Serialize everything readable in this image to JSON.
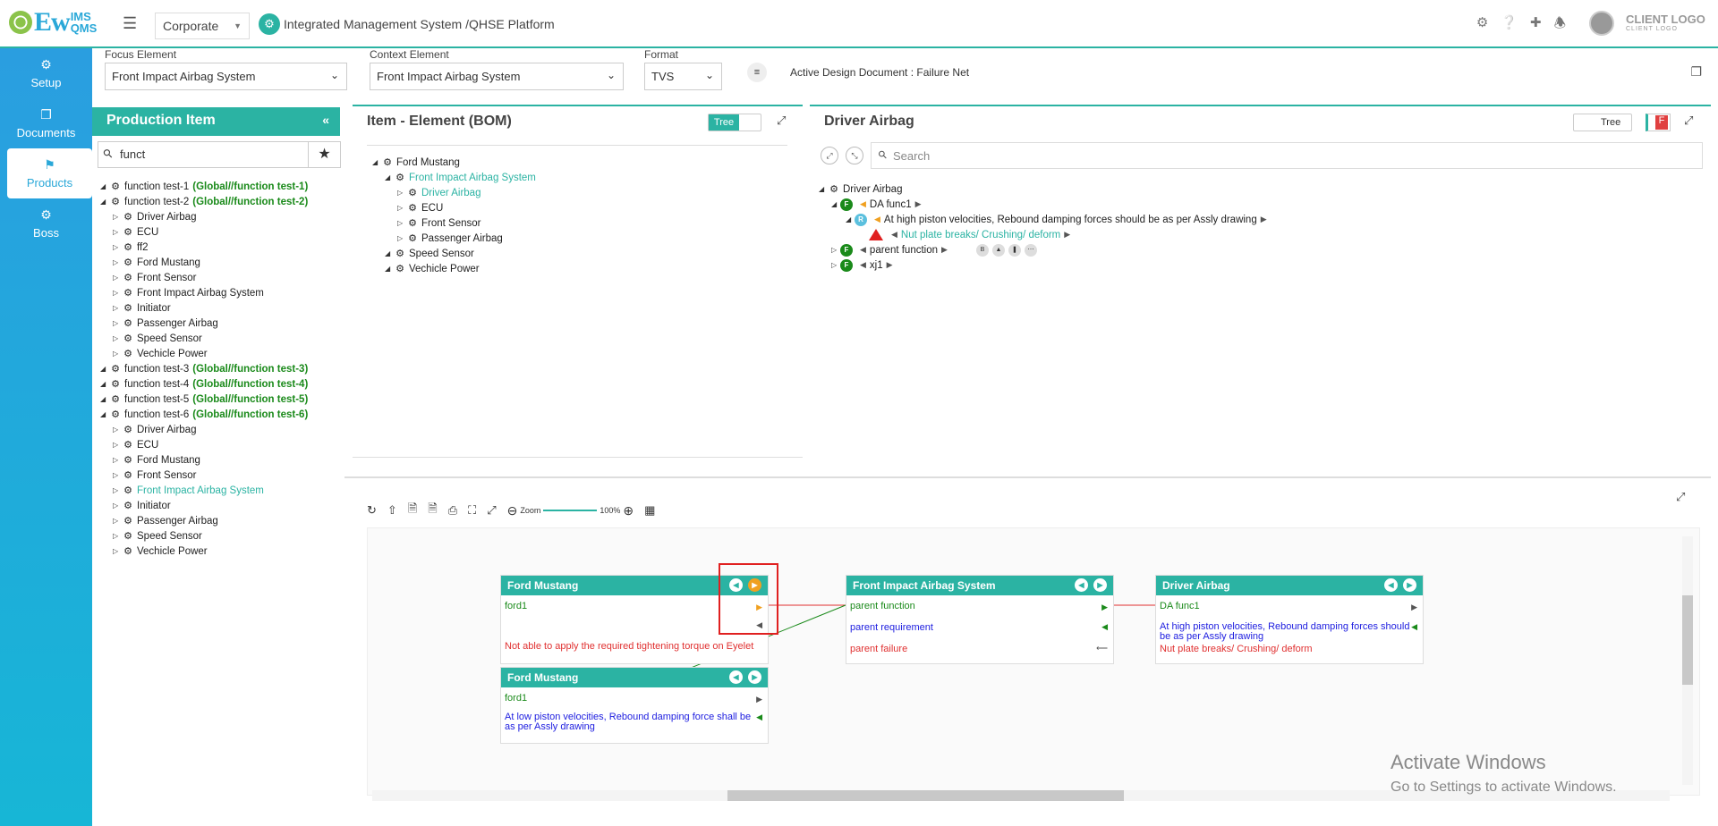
{
  "brand": {
    "logo_main": "Ew",
    "logo_top": "IMS",
    "logo_bottom": "QMS",
    "client_logo": "CLIENT LOGO",
    "client_logo_sub": "CLIENT LOGO"
  },
  "header": {
    "org_select": "Corporate",
    "app_title": "Integrated Management System /QHSE Platform"
  },
  "sidebar": {
    "items": [
      {
        "label": "Setup",
        "icon": "gears-icon"
      },
      {
        "label": "Documents",
        "icon": "documents-icon"
      },
      {
        "label": "Products",
        "icon": "flag-icon"
      },
      {
        "label": "Boss",
        "icon": "gears-icon"
      }
    ]
  },
  "focus": {
    "focus_label": "Focus Element",
    "focus_value": "Front Impact Airbag System",
    "context_label": "Context Element",
    "context_value": "Front Impact Airbag System",
    "format_label": "Format",
    "format_value": "TVS",
    "active_doc": "Active Design Document : Failure Net"
  },
  "production": {
    "title": "Production Item",
    "search_value": "funct",
    "tree": [
      {
        "label": "function test-1",
        "tag": "(Global//function test-1)",
        "level": 0
      },
      {
        "label": "function test-2",
        "tag": "(Global//function test-2)",
        "level": 0
      },
      {
        "label": "Driver Airbag",
        "level": 1
      },
      {
        "label": "ECU",
        "level": 1
      },
      {
        "label": "ff2",
        "level": 1
      },
      {
        "label": "Ford Mustang",
        "level": 1
      },
      {
        "label": "Front Sensor",
        "level": 1
      },
      {
        "label": "Front Impact Airbag System",
        "level": 1
      },
      {
        "label": "Initiator",
        "level": 1
      },
      {
        "label": "Passenger Airbag",
        "level": 1
      },
      {
        "label": "Speed Sensor",
        "level": 1
      },
      {
        "label": "Vechicle Power",
        "level": 1
      },
      {
        "label": "function test-3",
        "tag": "(Global//function test-3)",
        "level": 0
      },
      {
        "label": "function test-4",
        "tag": "(Global//function test-4)",
        "level": 0
      },
      {
        "label": "function test-5",
        "tag": "(Global//function test-5)",
        "level": 0
      },
      {
        "label": "function test-6",
        "tag": "(Global//function test-6)",
        "level": 0
      },
      {
        "label": "Driver Airbag",
        "level": 1
      },
      {
        "label": "ECU",
        "level": 1
      },
      {
        "label": "Ford Mustang",
        "level": 1
      },
      {
        "label": "Front Sensor",
        "level": 1
      },
      {
        "label": "Front Impact Airbag System",
        "level": 1,
        "highlight": true
      },
      {
        "label": "Initiator",
        "level": 1
      },
      {
        "label": "Passenger Airbag",
        "level": 1
      },
      {
        "label": "Speed Sensor",
        "level": 1
      },
      {
        "label": "Vechicle Power",
        "level": 1
      }
    ]
  },
  "bom": {
    "title": "Item - Element (BOM)",
    "toggle": "Tree",
    "tree": [
      {
        "label": "Ford Mustang",
        "level": 0
      },
      {
        "label": "Front Impact Airbag System",
        "level": 1,
        "highlight": true
      },
      {
        "label": "Driver Airbag",
        "level": 2,
        "highlight": true
      },
      {
        "label": "ECU",
        "level": 2
      },
      {
        "label": "Front Sensor",
        "level": 2
      },
      {
        "label": "Passenger Airbag",
        "level": 2
      },
      {
        "label": "Speed Sensor",
        "level": 1
      },
      {
        "label": "Vechicle Power",
        "level": 1
      }
    ]
  },
  "driver": {
    "title": "Driver Airbag",
    "toggle": "Tree",
    "f_badge": "F",
    "search_placeholder": "Search",
    "root": "Driver Airbag",
    "func1": "DA func1",
    "req": "At high piston velocities, Rebound damping forces should be as per Assly drawing",
    "failure": "Nut plate breaks/ Crushing/ deform",
    "func2": "parent function",
    "func3": "xj1",
    "badge_f": "F",
    "badge_r": "R"
  },
  "diagram": {
    "zoom_label": "Zoom",
    "zoom_value": "100%",
    "node1": {
      "title": "Ford Mustang",
      "l1": "ford1",
      "l2": "Not able to apply the required tightening torque on Eyelet"
    },
    "node2": {
      "title": "Ford Mustang",
      "l1": "ford1",
      "l2": "At low piston velocities, Rebound damping force shall be as per Assly drawing"
    },
    "node3": {
      "title": "Front Impact Airbag System",
      "l1": "parent function",
      "l2": "parent requirement",
      "l3": "parent failure"
    },
    "node4": {
      "title": "Driver Airbag",
      "l1": "DA func1",
      "l2": "At high piston velocities, Rebound damping forces should be as per Assly drawing",
      "l3": "Nut plate breaks/ Crushing/ deform"
    }
  },
  "watermark": {
    "title": "Activate Windows",
    "sub": "Go to Settings to activate Windows."
  }
}
